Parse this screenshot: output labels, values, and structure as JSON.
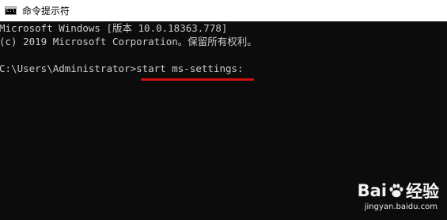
{
  "window": {
    "title": "命令提示符",
    "icon_label": "C:\\"
  },
  "console": {
    "lines": [
      "Microsoft Windows [版本 10.0.18363.778]",
      "(c) 2019 Microsoft Corporation。保留所有权利。",
      "",
      "C:\\Users\\Administrator>start ms-settings:"
    ],
    "highlighted_command": "start ms-settings:",
    "underline_color": "#d40f0f"
  },
  "watermark": {
    "brand_left": "Bai",
    "brand_right": "经验",
    "url": "jingyan.baidu.com"
  },
  "colors": {
    "console_bg": "#0c0c0c",
    "console_text": "#cccccc",
    "titlebar_bg": "#ffffff"
  }
}
